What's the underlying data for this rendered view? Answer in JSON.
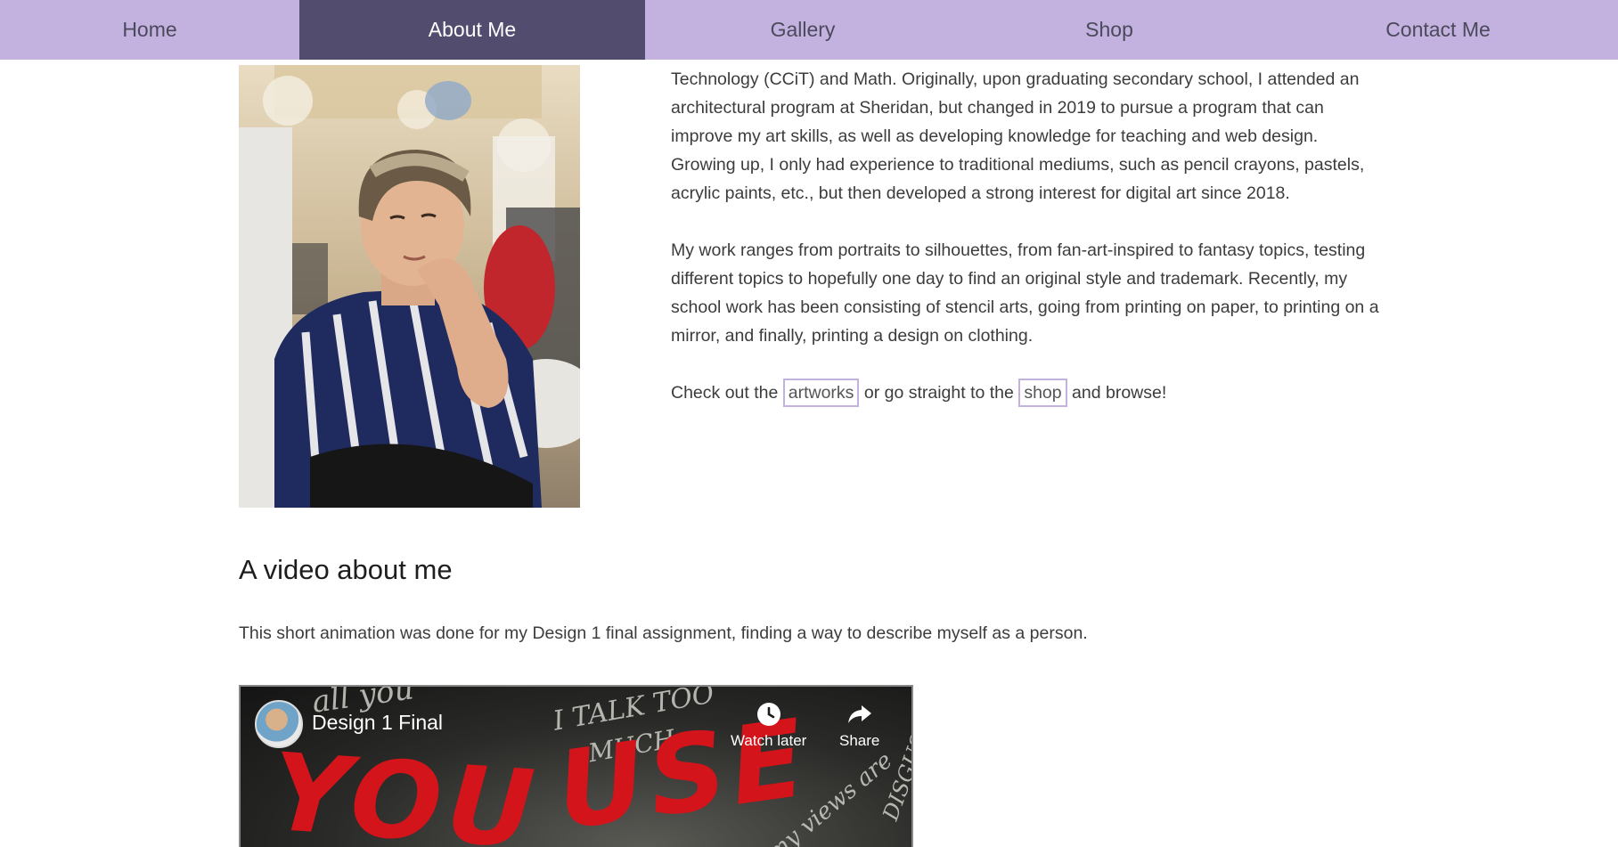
{
  "nav": {
    "items": [
      {
        "label": "Home",
        "active": false
      },
      {
        "label": "About Me",
        "active": true
      },
      {
        "label": "Gallery",
        "active": false
      },
      {
        "label": "Shop",
        "active": false
      },
      {
        "label": "Contact Me",
        "active": false
      }
    ]
  },
  "about": {
    "paragraph1": "Technology (CCiT) and Math. Originally, upon graduating secondary school, I attended an architectural program at Sheridan, but changed in 2019 to pursue a program that can improve my art skills, as well as developing knowledge for teaching and web design. Growing up, I only had experience to traditional mediums, such as pencil crayons, pastels, acrylic paints, etc., but then developed a strong interest for digital art since 2018.",
    "paragraph2": "My work ranges from portraits to silhouettes, from fan-art-inspired to fantasy topics, testing different topics to hopefully one day to find an original style and trademark. Recently, my school work has been consisting of stencil arts, going from printing on paper, to printing on a mirror, and finally, printing a design on clothing.",
    "cta": {
      "prefix": "Check out the",
      "link1": "artworks",
      "middle": "or go straight to the",
      "link2": "shop",
      "suffix": "and browse!"
    }
  },
  "video_section": {
    "heading": "A video about me",
    "description": "This short animation was done for my Design 1 final assignment, finding a way to describe myself as a person.",
    "player": {
      "title": "Design 1 Final",
      "watch_later_label": "Watch later",
      "share_label": "Share",
      "overlay_words": [
        "YOU",
        "USE"
      ],
      "scrawl_text": [
        "I TALK TOO",
        "MUCH",
        "all you",
        "my views are",
        "DISGUST"
      ]
    }
  },
  "colors": {
    "nav_bg": "#c3b2e0",
    "nav_active_bg": "#524d6e",
    "link_border": "#c3b2e0",
    "video_red": "#d3141b"
  }
}
